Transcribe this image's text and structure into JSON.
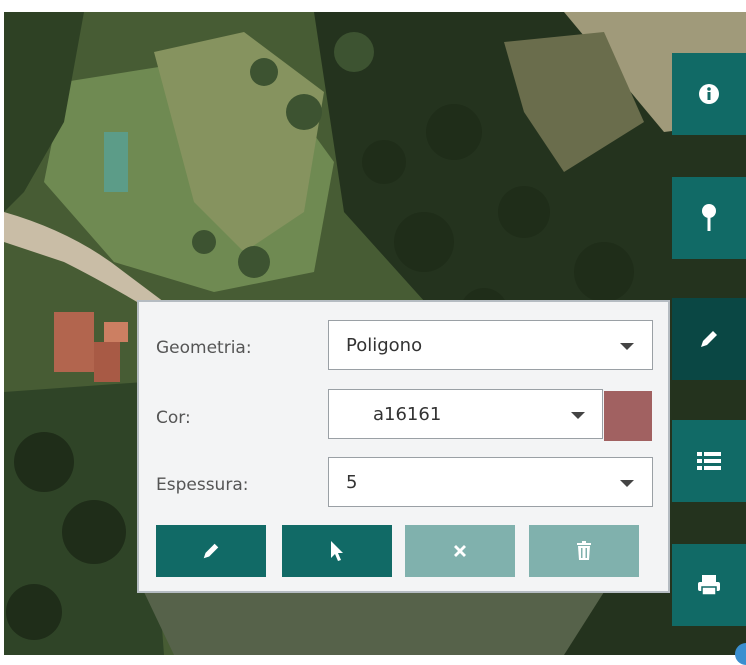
{
  "form": {
    "geometry_label": "Geometria:",
    "geometry_value": "Poligono",
    "color_label": "Cor:",
    "color_value": "a16161",
    "color_swatch": "#a16161",
    "thickness_label": "Espessura:",
    "thickness_value": "5"
  },
  "toolbar": {
    "side_buttons": [
      "info-icon",
      "map-pin-icon",
      "pencil-icon",
      "list-icon",
      "print-icon"
    ],
    "active_side_button": "pencil-icon",
    "draw_buttons": [
      "pencil-icon",
      "cursor-icon",
      "times-icon",
      "trash-icon"
    ]
  },
  "colors": {
    "accent": "#116a66",
    "accent_active": "#0a4744",
    "accent_disabled": "#80b1ad"
  }
}
